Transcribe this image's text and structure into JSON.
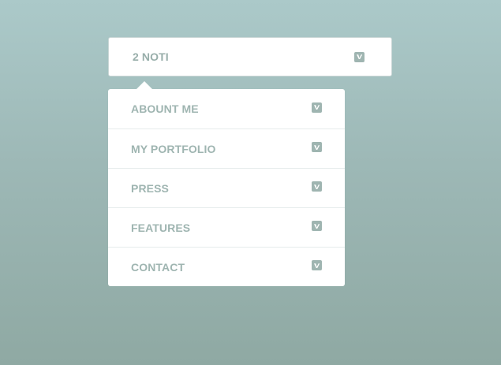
{
  "dropdown": {
    "trigger_label": "2 NOTI",
    "trigger_icon": "vimeo-icon"
  },
  "menu": {
    "items": [
      {
        "label": "ABOUNT ME",
        "icon": "vimeo-icon"
      },
      {
        "label": "MY PORTFOLIO",
        "icon": "vimeo-icon"
      },
      {
        "label": "PRESS",
        "icon": "vimeo-icon"
      },
      {
        "label": "FEATURES",
        "icon": "vimeo-icon"
      },
      {
        "label": "CONTACT",
        "icon": "vimeo-icon"
      }
    ]
  },
  "colors": {
    "background_top": "#abc9c9",
    "background_bottom": "#8fa9a3",
    "accent": "#9fb5b1",
    "panel": "#ffffff"
  }
}
